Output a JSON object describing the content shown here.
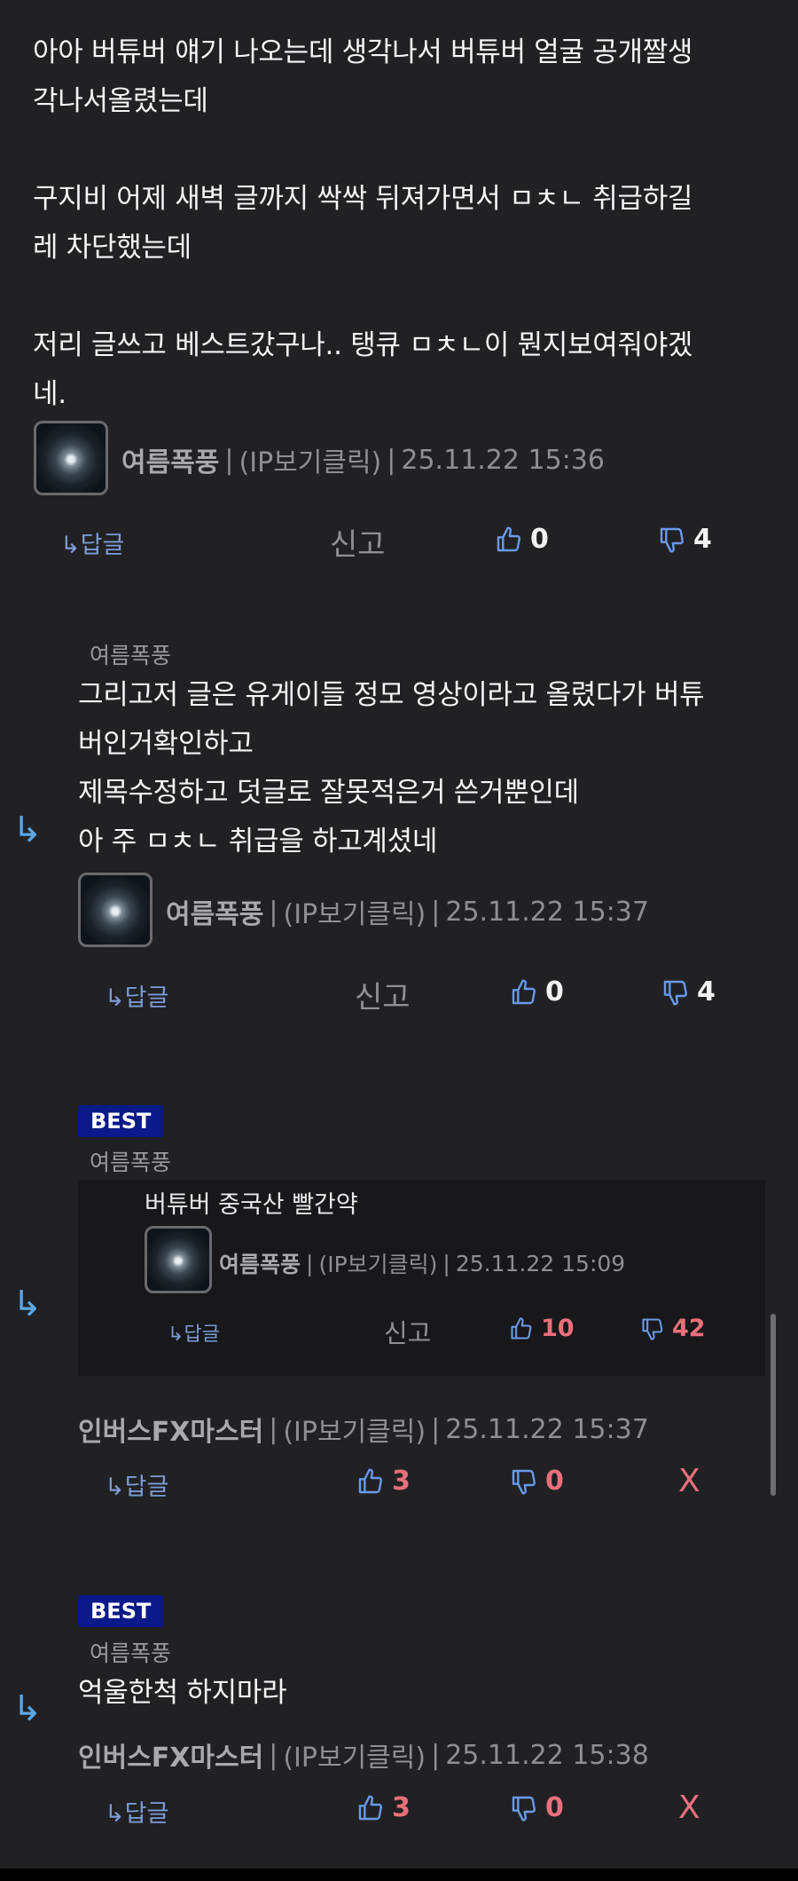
{
  "comment1": {
    "lines": [
      "아아  버튜버 얘기 나오는데 생각나서 버튜버 얼굴 공개짤생",
      "각나서올렸는데",
      "",
      "구지비 어제 새벽 글까지 싹싹 뒤져가면서 ㅁㅊㄴ 취급하길",
      "레 차단했는데",
      "",
      "저리 글쓰고 베스트갔구나.. 탱큐 ㅁㅊㄴ이 뭔지보여줘야겠",
      "네."
    ],
    "author": "여름폭풍",
    "ip": "(IP보기클릭)",
    "time": "25.11.22 15:36",
    "reply": "↳답글",
    "report": "신고",
    "up": "0",
    "down": "4"
  },
  "comment2": {
    "replying_to": "여름폭풍",
    "lines": [
      "그리고저 글은 유게이들 정모 영상이라고 올렸다가 버튜",
      "버인거확인하고",
      "제목수정하고 덧글로 잘못적은거 쓴거뿐인데",
      "아 주 ㅁㅊㄴ 취급을 하고계셨네"
    ],
    "author": "여름폭풍",
    "ip": "(IP보기클릭)",
    "time": "25.11.22 15:37",
    "reply": "↳답글",
    "report": "신고",
    "up": "0",
    "down": "4"
  },
  "comment3": {
    "badge": "BEST",
    "replying_to": "여름폭풍",
    "quote": {
      "text": "버튜버 중국산 빨간약",
      "author": "여름폭풍",
      "ip": "(IP보기클릭)",
      "time": "25.11.22 15:09",
      "reply": "↳답글",
      "report": "신고",
      "up": "10",
      "down": "42"
    },
    "author": "인버스FX마스터",
    "ip": "(IP보기클릭)",
    "time": "25.11.22 15:37",
    "reply": "↳답글",
    "up": "3",
    "down": "0",
    "delete": "X"
  },
  "comment4": {
    "badge": "BEST",
    "replying_to": "여름폭풍",
    "text": "억울한척 하지마라",
    "author": "인버스FX마스터",
    "ip": "(IP보기클릭)",
    "time": "25.11.22 15:38",
    "reply": "↳답글",
    "up": "3",
    "down": "0",
    "delete": "X"
  },
  "icons": {
    "reply_arrow": "reply-arrow-icon",
    "thumb_up": "thumb-up-icon",
    "thumb_down": "thumb-down-icon"
  },
  "colors": {
    "background": "#212124",
    "link_blue": "#7c9bd4",
    "vote_red": "#e8707a",
    "best_badge": "#0a1a8a"
  }
}
